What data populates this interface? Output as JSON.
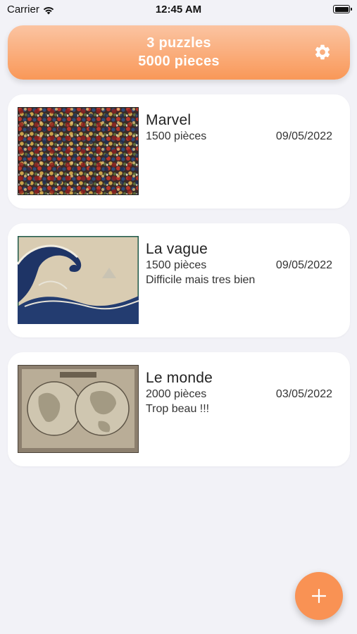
{
  "status_bar": {
    "carrier": "Carrier",
    "time": "12:45 AM"
  },
  "header": {
    "puzzle_count": "3 puzzles",
    "piece_count": "5000 pieces",
    "settings_icon": "gear-icon",
    "gradient_top": "#fbc4a2",
    "gradient_bottom": "#f99858"
  },
  "puzzles": [
    {
      "title": "Marvel",
      "pieces": "1500 pièces",
      "date": "09/05/2022",
      "note": ""
    },
    {
      "title": "La vague",
      "pieces": "1500 pièces",
      "date": "09/05/2022",
      "note": "Difficile mais tres bien"
    },
    {
      "title": "Le monde",
      "pieces": "2000 pièces",
      "date": "03/05/2022",
      "note": "Trop beau !!!"
    }
  ],
  "fab": {
    "icon": "plus-icon",
    "color": "#f99254"
  }
}
